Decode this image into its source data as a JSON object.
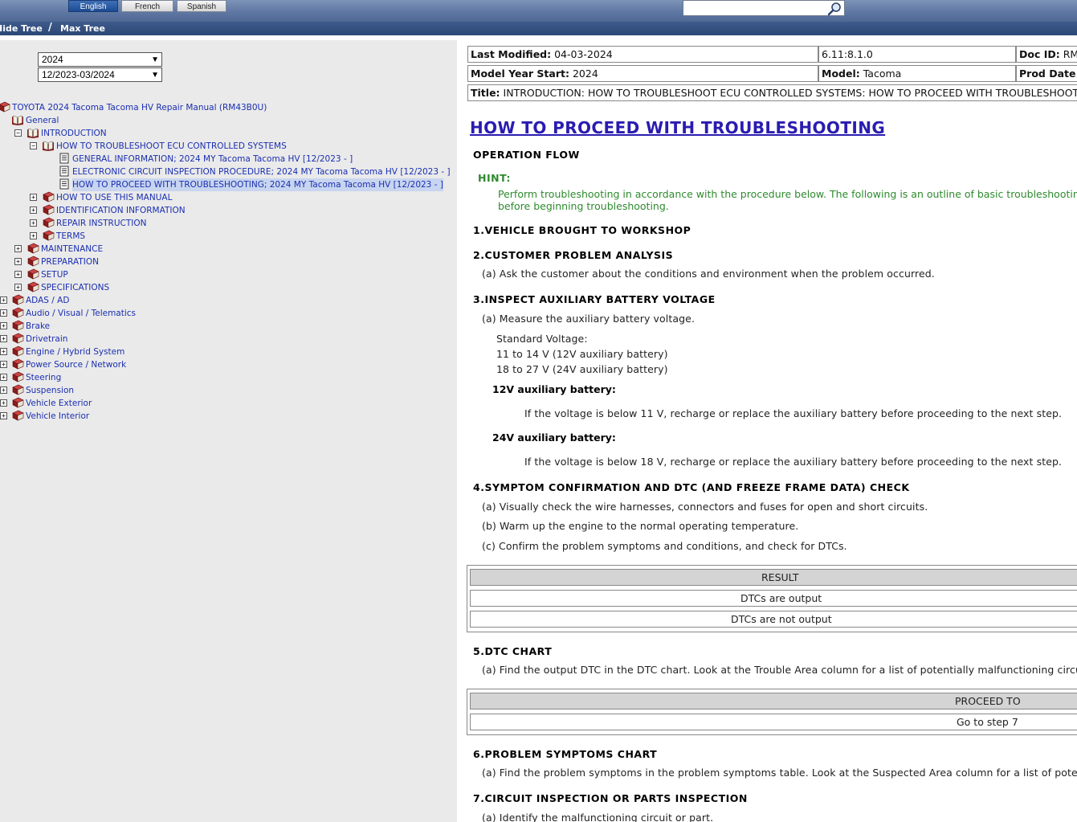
{
  "top": {
    "languages": [
      "English",
      "French",
      "Spanish"
    ],
    "active_language": "English",
    "search_value": "",
    "hide_tree": "Hide Tree",
    "max_tree": "Max Tree"
  },
  "filters": {
    "year": "2024",
    "date_range": "12/2023-03/2024"
  },
  "tree": [
    {
      "label": "TOYOTA 2024 Tacoma Tacoma HV Repair Manual (RM43B0U)",
      "expander": ""
    },
    {
      "label": "General",
      "expander": "−"
    },
    {
      "label": "INTRODUCTION",
      "expander": "−"
    },
    {
      "label": "HOW TO TROUBLESHOOT ECU CONTROLLED SYSTEMS",
      "expander": "−"
    },
    {
      "label": "GENERAL INFORMATION; 2024 MY Tacoma Tacoma HV [12/2023 -        ]",
      "expander": ""
    },
    {
      "label": "ELECTRONIC CIRCUIT INSPECTION PROCEDURE; 2024 MY Tacoma Tacoma HV [12/2023 -        ]",
      "expander": ""
    },
    {
      "label": "HOW TO PROCEED WITH TROUBLESHOOTING; 2024 MY Tacoma Tacoma HV [12/2023 -        ]",
      "expander": ""
    },
    {
      "label": "HOW TO USE THIS MANUAL",
      "expander": "+"
    },
    {
      "label": "IDENTIFICATION INFORMATION",
      "expander": "+"
    },
    {
      "label": "REPAIR INSTRUCTION",
      "expander": "+"
    },
    {
      "label": "TERMS",
      "expander": "+"
    },
    {
      "label": "MAINTENANCE",
      "expander": "+"
    },
    {
      "label": "PREPARATION",
      "expander": "+"
    },
    {
      "label": "SETUP",
      "expander": "+"
    },
    {
      "label": "SPECIFICATIONS",
      "expander": "+"
    },
    {
      "label": "ADAS / AD",
      "expander": "+"
    },
    {
      "label": "Audio / Visual / Telematics",
      "expander": "+"
    },
    {
      "label": "Brake",
      "expander": "+"
    },
    {
      "label": "Drivetrain",
      "expander": "+"
    },
    {
      "label": "Engine / Hybrid System",
      "expander": "+"
    },
    {
      "label": "Power Source / Network",
      "expander": "+"
    },
    {
      "label": "Steering",
      "expander": "+"
    },
    {
      "label": "Suspension",
      "expander": "+"
    },
    {
      "label": "Vehicle Exterior",
      "expander": "+"
    },
    {
      "label": "Vehicle Interior",
      "expander": "+"
    }
  ],
  "doc_header": {
    "last_modified_label": "Last Modified:",
    "last_modified": "04-03-2024",
    "version": "6.11:8.1.0",
    "doc_id_label": "Doc ID:",
    "doc_id": "RM",
    "model_year_label": "Model Year Start:",
    "model_year": "2024",
    "model_label": "Model:",
    "model": "Tacoma",
    "prod_date_label": "Prod Date",
    "title_label": "Title:",
    "title": "INTRODUCTION: HOW TO TROUBLESHOOT ECU CONTROLLED SYSTEMS: HOW TO PROCEED WITH TROUBLESHOOTIN"
  },
  "doc": {
    "heading": "HOW TO PROCEED WITH TROUBLESHOOTING",
    "operation_flow": "OPERATION FLOW",
    "hint_label": "HINT:",
    "hint_line1": "Perform troubleshooting in accordance with the procedure below. The following is an outline of basic troubleshooting pr",
    "hint_line2": "before beginning troubleshooting.",
    "s1": "1.VEHICLE BROUGHT TO WORKSHOP",
    "s2": "2.CUSTOMER PROBLEM ANALYSIS",
    "s2a": "(a) Ask the customer about the conditions and environment when the problem occurred.",
    "s3": "3.INSPECT AUXILIARY BATTERY VOLTAGE",
    "s3a": "(a) Measure the auxiliary battery voltage.",
    "std_voltage": "Standard Voltage:",
    "v12": "11 to 14 V (12V auxiliary battery)",
    "v24": "18 to 27 V (24V auxiliary battery)",
    "b12_label": "12V auxiliary battery:",
    "b12_text": "If the voltage is below 11 V, recharge or replace the auxiliary battery before proceeding to the next step.",
    "b24_label": "24V auxiliary battery:",
    "b24_text": "If the voltage is below 18 V, recharge or replace the auxiliary battery before proceeding to the next step.",
    "s4": "4.SYMPTOM CONFIRMATION AND DTC (AND FREEZE FRAME DATA) CHECK",
    "s4a": "(a) Visually check the wire harnesses, connectors and fuses for open and short circuits.",
    "s4b": "(b) Warm up the engine to the normal operating temperature.",
    "s4c": "(c) Confirm the problem symptoms and conditions, and check for DTCs.",
    "result_header": "RESULT",
    "result_rows": [
      "DTCs are output",
      "DTCs are not output"
    ],
    "s5": "5.DTC CHART",
    "s5a": "(a) Find the output DTC in the DTC chart. Look at the Trouble Area column for a list of potentially malfunctioning circuits a",
    "proceed_header": "PROCEED TO",
    "proceed_rows": [
      "Go to step 7"
    ],
    "s6": "6.PROBLEM SYMPTOMS CHART",
    "s6a": "(a) Find the problem symptoms in the problem symptoms table. Look at the Suspected Area column for a list of potentially",
    "s7": "7.CIRCUIT INSPECTION OR PARTS INSPECTION",
    "s7a": "(a) Identify the malfunctioning circuit or part."
  }
}
